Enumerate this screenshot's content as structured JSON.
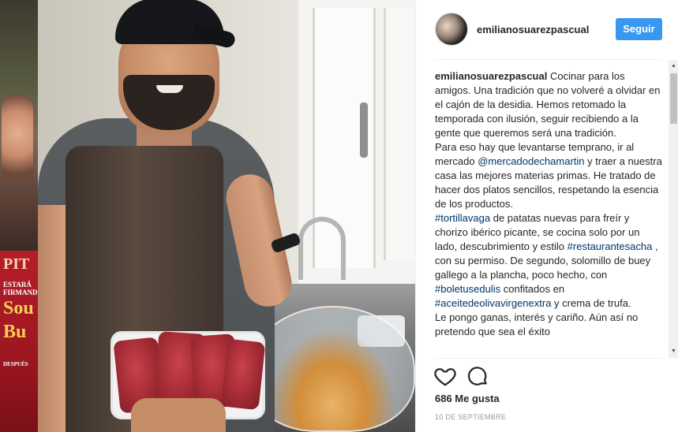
{
  "post": {
    "username": "emilianosuarezpascual",
    "follow_label": "Seguir",
    "caption_parts": {
      "p1_user": "emilianosuarezpascual",
      "p1_text": " Cocinar para los amigos. Una tradición que no volveré a olvidar en el cajón de la desidia. Hemos retomado la temporada con ilusión, seguir recibiendo a la gente que queremos será una tradición.",
      "p2_a": "Para eso hay que levantarse temprano, ir al mercado ",
      "p2_link": "@mercadodechamartin",
      "p2_b": " y traer a nuestra casa las mejores materias primas. He tratado de hacer dos platos sencillos, respetando la esencia de los productos.",
      "p3_link1": "#tortillavaga",
      "p3_a": " de patatas nuevas para freír y chorizo ibérico picante, se cocina solo por un lado, descubrimiento y estilo ",
      "p3_link2": "#restaurantesacha",
      "p3_b": " , con su permiso. De segundo, solomillo de buey gallego a la plancha, poco hecho, con ",
      "p3_link3": "#boletusedulis",
      "p3_c": " confitados en ",
      "p3_link4": "#aceitedeolivavirgenextra",
      "p3_d": " y crema de trufa.",
      "p4": "Le pongo ganas, interés y cariño. Aún así no pretendo que sea el éxito"
    },
    "likes": "686 Me gusta",
    "date": "10 DE SEPTIEMBRE"
  },
  "backdrop": {
    "poster_title": "PIT",
    "poster_line": "ESTARÁ FIRMANDO",
    "poster_word1": "Sou",
    "poster_word2": "Bu",
    "poster_small": "DESPUÉS"
  },
  "colors": {
    "accent": "#3897f0",
    "link": "#003569",
    "text": "#262626",
    "muted": "#999999"
  },
  "icons": {
    "like": "heart-icon",
    "comment": "comment-icon",
    "scroll_up": "scroll-up-arrow",
    "scroll_down": "scroll-down-arrow"
  }
}
